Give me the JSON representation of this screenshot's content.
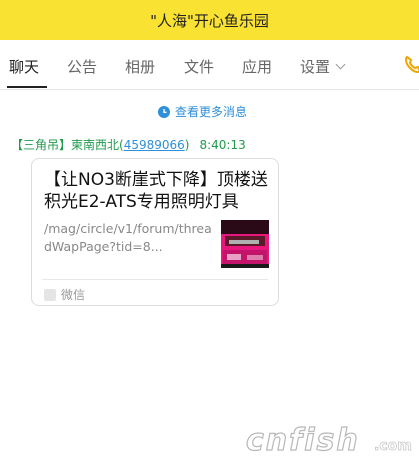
{
  "window": {
    "title": "\"人海\"开心鱼乐园"
  },
  "tabs": [
    {
      "label": "聊天",
      "active": true
    },
    {
      "label": "公告"
    },
    {
      "label": "相册"
    },
    {
      "label": "文件"
    },
    {
      "label": "应用"
    },
    {
      "label": "设置"
    }
  ],
  "chat": {
    "more_messages": "查看更多消息",
    "message": {
      "sender_name": "【三角吊】柬南西北",
      "sender_id": "45989066",
      "time": "8:40:13",
      "card": {
        "title": "【让NO3断崖式下降】顶楼送积光E2-ATS专用照明灯具",
        "description": "/mag/circle/v1/forum/threadWapPage?tid=8...",
        "source": "微信"
      }
    }
  },
  "watermark": {
    "text": "cnfish"
  },
  "colors": {
    "title_bar": "#f9e232",
    "link_blue": "#2f8fd8",
    "sender_green": "#1f9a4b"
  }
}
